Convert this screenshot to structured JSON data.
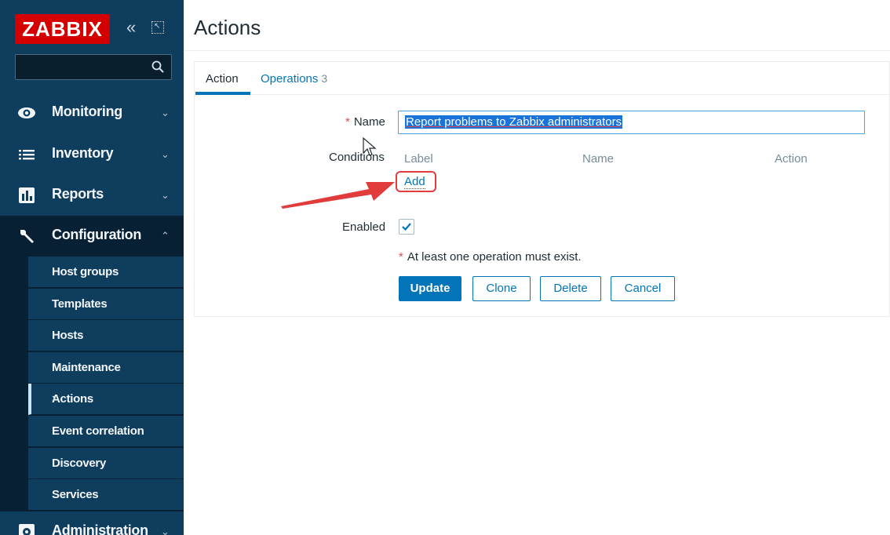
{
  "sidebar": {
    "logo": "ZABBIX",
    "collapse_symbol": "«",
    "kiosk_symbol": "↖",
    "search": {
      "placeholder": "",
      "value": ""
    },
    "menu": [
      {
        "label": "Monitoring",
        "icon": "eye-icon",
        "caret": "⌄"
      },
      {
        "label": "Inventory",
        "icon": "list-icon",
        "caret": "⌄"
      },
      {
        "label": "Reports",
        "icon": "bar-chart-icon",
        "caret": "⌄"
      },
      {
        "label": "Configuration",
        "icon": "wrench-icon",
        "caret": "⌃"
      },
      {
        "label": "Administration",
        "icon": "gear-icon",
        "caret": "⌄"
      }
    ],
    "submenu": [
      {
        "label": "Host groups"
      },
      {
        "label": "Templates"
      },
      {
        "label": "Hosts"
      },
      {
        "label": "Maintenance"
      },
      {
        "label": "Actions",
        "caret": "›"
      },
      {
        "label": "Event correlation"
      },
      {
        "label": "Discovery"
      },
      {
        "label": "Services"
      }
    ]
  },
  "header": {
    "title": "Actions"
  },
  "tabs": [
    {
      "label": "Action"
    },
    {
      "label": "Operations",
      "count": "3"
    }
  ],
  "form": {
    "name_required_mark": "*",
    "name_label": "Name",
    "name_value": "Report problems to Zabbix administrators",
    "conditions_label": "Conditions",
    "conditions_columns": [
      "Label",
      "Name",
      "Action"
    ],
    "add_link": "Add",
    "enabled_label": "Enabled",
    "enabled_checked": true,
    "hint_mark": "*",
    "hint": "At least one operation must exist.",
    "buttons": {
      "update": "Update",
      "clone": "Clone",
      "delete": "Delete",
      "cancel": "Cancel"
    }
  },
  "colors": {
    "sidebar": "#0e3d5e",
    "accent": "#0275b8",
    "logo": "#d40000",
    "annotation": "#e23b3b"
  }
}
